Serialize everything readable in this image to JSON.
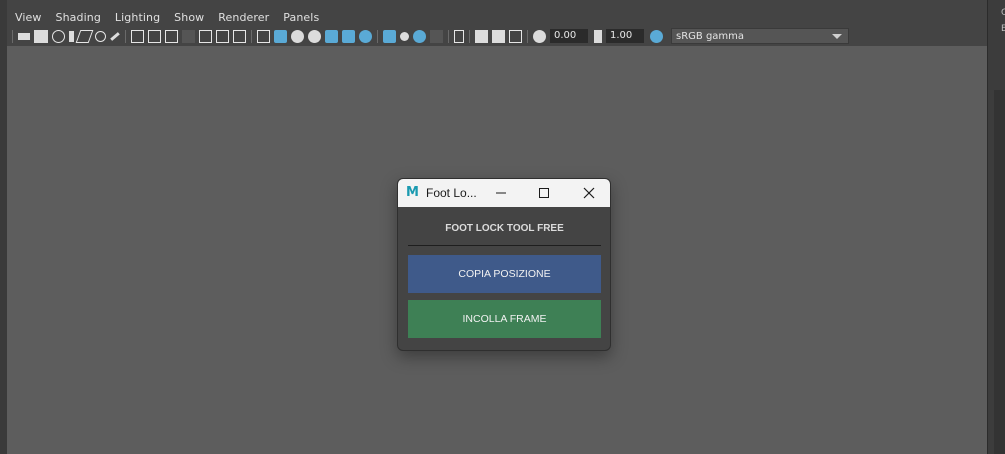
{
  "menubar": {
    "items": [
      "View",
      "Shading",
      "Lighting",
      "Show",
      "Renderer",
      "Panels"
    ]
  },
  "toolbar": {
    "exposure_value": "0.00",
    "gamma_value": "1.00",
    "colorspace": "sRGB gamma",
    "colors": {
      "active_icon": "#5aaad6",
      "field_bg": "#2b2b2b"
    }
  },
  "viewport": {
    "background": "#5d5d5d"
  },
  "dialog": {
    "title": "Foot Lo...",
    "app_icon_letter": "M",
    "header": "FOOT LOCK TOOL FREE",
    "copy_button": "COPIA POSIZIONE",
    "paste_button": "INCOLLA FRAME",
    "colors": {
      "copy_button": "#3f5a8a",
      "paste_button": "#3e8055"
    }
  },
  "right_panel": {
    "chars": [
      "C",
      "E"
    ]
  }
}
